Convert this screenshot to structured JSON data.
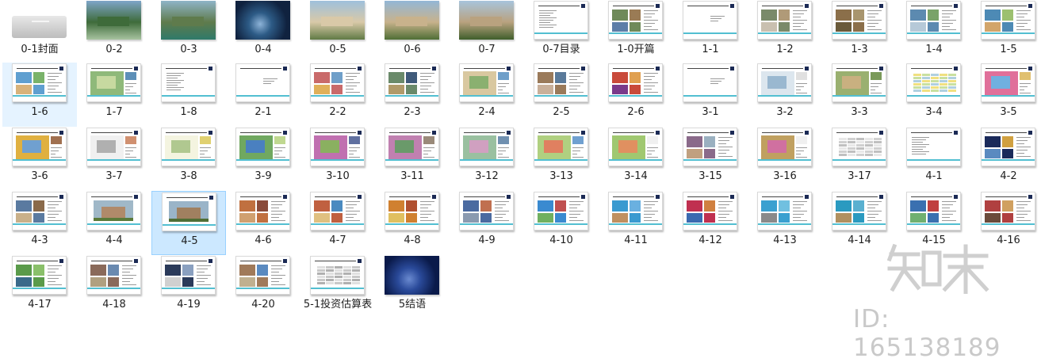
{
  "items": [
    {
      "label": "0-1封面",
      "kind": "cover"
    },
    {
      "label": "0-2",
      "kind": "photo",
      "colors": [
        "#7ea5c9",
        "#3e6b3a",
        "#a7c3a0"
      ]
    },
    {
      "label": "0-3",
      "kind": "photo",
      "colors": [
        "#8fb4c8",
        "#5f7b4c",
        "#2f7a6a"
      ]
    },
    {
      "label": "0-4",
      "kind": "photo",
      "colors": [
        "#10223f",
        "#2d5b86",
        "#8db3d8"
      ]
    },
    {
      "label": "0-5",
      "kind": "photo",
      "colors": [
        "#9ec0dc",
        "#d9c9a8",
        "#607a45"
      ]
    },
    {
      "label": "0-6",
      "kind": "photo",
      "colors": [
        "#93b7d6",
        "#c8b28c",
        "#4f6e35"
      ]
    },
    {
      "label": "0-7",
      "kind": "photo",
      "colors": [
        "#a7c4dc",
        "#b9a27f",
        "#3f5e2b"
      ]
    },
    {
      "label": "0-7目录",
      "kind": "slide",
      "layout": "text"
    },
    {
      "label": "1-0开篇",
      "kind": "slide",
      "layout": "imgtext",
      "colors": [
        "#6f8a5a",
        "#9a7b55",
        "#5d7ea8"
      ]
    },
    {
      "label": "1-1",
      "kind": "slide",
      "layout": "blank"
    },
    {
      "label": "1-2",
      "kind": "slide",
      "layout": "imgtext",
      "colors": [
        "#7a8a6a",
        "#b09a78",
        "#c9c0b0"
      ]
    },
    {
      "label": "1-3",
      "kind": "slide",
      "layout": "imgtext",
      "colors": [
        "#8b6f4a",
        "#a8956e",
        "#6a5a3a"
      ]
    },
    {
      "label": "1-4",
      "kind": "slide",
      "layout": "imgtext",
      "colors": [
        "#5c8ab0",
        "#7aa36a",
        "#b6c9d8"
      ]
    },
    {
      "label": "1-5",
      "kind": "slide",
      "layout": "imgtext",
      "colors": [
        "#4d8ab5",
        "#9cc06f",
        "#d2a56a"
      ]
    },
    {
      "label": "1-6",
      "kind": "slide",
      "layout": "imgtext",
      "colors": [
        "#5f9fd0",
        "#7ab36a",
        "#d8b27a"
      ]
    },
    {
      "label": "1-7",
      "kind": "slide",
      "layout": "map",
      "colors": [
        "#8fb97a",
        "#c7d9a0",
        "#5d8fb8"
      ]
    },
    {
      "label": "1-8",
      "kind": "slide",
      "layout": "text"
    },
    {
      "label": "2-1",
      "kind": "slide",
      "layout": "blank"
    },
    {
      "label": "2-2",
      "kind": "slide",
      "layout": "imgtext",
      "colors": [
        "#c96a6a",
        "#6f9fc9",
        "#e0b05a"
      ]
    },
    {
      "label": "2-3",
      "kind": "slide",
      "layout": "imgtext",
      "colors": [
        "#6a8a6a",
        "#3f5a7a",
        "#b09a6a"
      ]
    },
    {
      "label": "2-4",
      "kind": "slide",
      "layout": "map",
      "colors": [
        "#d9c8a0",
        "#8ab070",
        "#6f9fc9"
      ]
    },
    {
      "label": "2-5",
      "kind": "slide",
      "layout": "imgtext",
      "colors": [
        "#9a7a5a",
        "#5a7a9a",
        "#c9b09a"
      ]
    },
    {
      "label": "2-6",
      "kind": "slide",
      "layout": "imgtext",
      "colors": [
        "#c94a3a",
        "#e0a050",
        "#7a3a8a"
      ]
    },
    {
      "label": "3-1",
      "kind": "slide",
      "layout": "blank"
    },
    {
      "label": "3-2",
      "kind": "slide",
      "layout": "map",
      "colors": [
        "#dce6ee",
        "#9ab8d0",
        "#e0e0e0"
      ]
    },
    {
      "label": "3-3",
      "kind": "slide",
      "layout": "map",
      "colors": [
        "#9ab070",
        "#c9b080",
        "#7a9a5a"
      ]
    },
    {
      "label": "3-4",
      "kind": "slide",
      "layout": "table",
      "colors": [
        "#f0e080",
        "#c9e0a0",
        "#b0d0e0"
      ]
    },
    {
      "label": "3-5",
      "kind": "slide",
      "layout": "map",
      "colors": [
        "#e0709a",
        "#70b0e0",
        "#e0c070"
      ]
    },
    {
      "label": "3-6",
      "kind": "slide",
      "layout": "map",
      "colors": [
        "#e0b040",
        "#70a0d0",
        "#a07050"
      ]
    },
    {
      "label": "3-7",
      "kind": "slide",
      "layout": "map",
      "colors": [
        "#f0f0f0",
        "#b0b0b0",
        "#d09070"
      ]
    },
    {
      "label": "3-8",
      "kind": "slide",
      "layout": "map",
      "colors": [
        "#f4f4e0",
        "#b0c890",
        "#e0d070"
      ]
    },
    {
      "label": "3-9",
      "kind": "slide",
      "layout": "map",
      "colors": [
        "#70a860",
        "#4a80c0",
        "#c0d890"
      ]
    },
    {
      "label": "3-10",
      "kind": "slide",
      "layout": "map",
      "colors": [
        "#c070b0",
        "#8ab060",
        "#6070a0"
      ]
    },
    {
      "label": "3-11",
      "kind": "slide",
      "layout": "map",
      "colors": [
        "#c080b0",
        "#6a9a6a",
        "#9a8a7a"
      ]
    },
    {
      "label": "3-12",
      "kind": "slide",
      "layout": "map",
      "colors": [
        "#9ac0a0",
        "#d0a0c0",
        "#7090b0"
      ]
    },
    {
      "label": "3-13",
      "kind": "slide",
      "layout": "map",
      "colors": [
        "#b0d080",
        "#e08060",
        "#70a0d0"
      ]
    },
    {
      "label": "3-14",
      "kind": "slide",
      "layout": "map",
      "colors": [
        "#a0c870",
        "#e09060",
        "#f0f0f0"
      ]
    },
    {
      "label": "3-15",
      "kind": "slide",
      "layout": "imgtext",
      "colors": [
        "#8a6a8a",
        "#9ab0c0",
        "#c0a080"
      ]
    },
    {
      "label": "3-16",
      "kind": "slide",
      "layout": "map",
      "colors": [
        "#c0a060",
        "#d070a0",
        "#f0f0f0"
      ]
    },
    {
      "label": "3-17",
      "kind": "slide",
      "layout": "table",
      "colors": [
        "#e8e8e8",
        "#d0d0d0",
        "#c0c0c0"
      ]
    },
    {
      "label": "4-1",
      "kind": "slide",
      "layout": "text"
    },
    {
      "label": "4-2",
      "kind": "slide",
      "layout": "imgtext",
      "colors": [
        "#1a2a5a",
        "#d0a040",
        "#5a8ac0"
      ]
    },
    {
      "label": "4-3",
      "kind": "slide",
      "layout": "imgtext",
      "colors": [
        "#5a7aa0",
        "#8a6a4a",
        "#c9b08a"
      ]
    },
    {
      "label": "4-4",
      "kind": "slide",
      "layout": "wide",
      "colors": [
        "#a0b8c8",
        "#b08a6a",
        "#5a7a3a"
      ]
    },
    {
      "label": "4-5",
      "kind": "slide",
      "layout": "wide",
      "colors": [
        "#9ab4c8",
        "#a08060",
        "#4f6e35"
      ]
    },
    {
      "label": "4-6",
      "kind": "slide",
      "layout": "imgtext",
      "colors": [
        "#c07040",
        "#8a4a3a",
        "#d0a070"
      ]
    },
    {
      "label": "4-7",
      "kind": "slide",
      "layout": "imgtext",
      "colors": [
        "#c06040",
        "#4a8ac0",
        "#e0c080"
      ]
    },
    {
      "label": "4-8",
      "kind": "slide",
      "layout": "imgtext",
      "colors": [
        "#d08030",
        "#b05030",
        "#e0c060"
      ]
    },
    {
      "label": "4-9",
      "kind": "slide",
      "layout": "imgtext",
      "colors": [
        "#4a6aa0",
        "#c07050",
        "#8a9ab0"
      ]
    },
    {
      "label": "4-10",
      "kind": "slide",
      "layout": "imgtext",
      "colors": [
        "#3a8ad0",
        "#c05050",
        "#70b060"
      ]
    },
    {
      "label": "4-11",
      "kind": "slide",
      "layout": "imgtext",
      "colors": [
        "#3a9ad0",
        "#6ab0e0",
        "#c09060"
      ]
    },
    {
      "label": "4-12",
      "kind": "slide",
      "layout": "imgtext",
      "colors": [
        "#c03050",
        "#d08040",
        "#3a6ab0"
      ]
    },
    {
      "label": "4-13",
      "kind": "slide",
      "layout": "imgtext",
      "colors": [
        "#3aa0d0",
        "#70c0e0",
        "#8a8a8a"
      ]
    },
    {
      "label": "4-14",
      "kind": "slide",
      "layout": "imgtext",
      "colors": [
        "#2a9ac0",
        "#5ab0d0",
        "#b09060"
      ]
    },
    {
      "label": "4-15",
      "kind": "slide",
      "layout": "imgtext",
      "colors": [
        "#3a70b0",
        "#c04040",
        "#70b070"
      ]
    },
    {
      "label": "4-16",
      "kind": "slide",
      "layout": "imgtext",
      "colors": [
        "#b04040",
        "#d0a060",
        "#6a4a3a"
      ]
    },
    {
      "label": "4-17",
      "kind": "slide",
      "layout": "imgtext",
      "colors": [
        "#5a9a4a",
        "#8ac06a",
        "#3a6a8a"
      ]
    },
    {
      "label": "4-18",
      "kind": "slide",
      "layout": "imgtext",
      "colors": [
        "#8a6a5a",
        "#6a8ab0",
        "#b0a080"
      ]
    },
    {
      "label": "4-19",
      "kind": "slide",
      "layout": "imgtext",
      "colors": [
        "#2a3a5a",
        "#8aa0c0",
        "#d0d0d0"
      ]
    },
    {
      "label": "4-20",
      "kind": "slide",
      "layout": "imgtext",
      "colors": [
        "#a07a5a",
        "#5a8ac0",
        "#c0b090"
      ]
    },
    {
      "label": "5-1投资估算表",
      "kind": "slide",
      "layout": "table",
      "colors": [
        "#e0e0e0",
        "#c8c8c8",
        "#b0b0b0"
      ]
    },
    {
      "label": "5结语",
      "kind": "photo",
      "colors": [
        "#0a1a4a",
        "#2a4a9a",
        "#6a8ad0"
      ]
    }
  ],
  "selected_labels": [
    "4-5"
  ],
  "hover_labels": [
    "1-6"
  ],
  "watermark": {
    "logo": "知末",
    "id": "ID: 165138189"
  }
}
